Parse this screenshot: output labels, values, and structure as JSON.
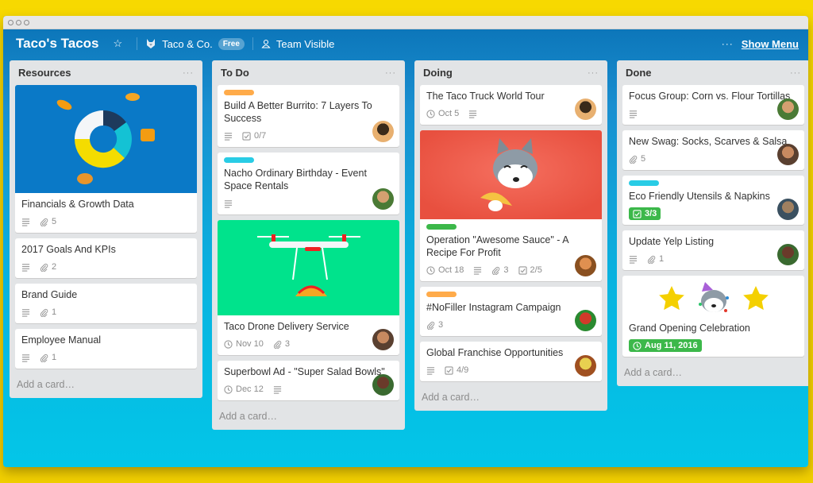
{
  "window": {
    "title_dots": [
      "close",
      "minimize",
      "zoom"
    ]
  },
  "header": {
    "board_title": "Taco's Tacos",
    "star_icon": "star-icon",
    "team_name": "Taco & Co.",
    "team_plan_badge": "Free",
    "visibility_label": "Team Visible",
    "more_label": "···",
    "show_menu_label": "Show Menu"
  },
  "lists": [
    {
      "title": "Resources",
      "menu": "···",
      "add_card": "Add a card…",
      "cards": [
        {
          "title": "Financials & Growth Data",
          "cover": "donut-chart-tacos",
          "cover_color": "#0a79c7",
          "description": true,
          "attachments": "5"
        },
        {
          "title": "2017 Goals And KPIs",
          "description": true,
          "attachments": "2"
        },
        {
          "title": "Brand Guide",
          "description": true,
          "attachments": "1"
        },
        {
          "title": "Employee Manual",
          "description": true,
          "attachments": "1"
        }
      ]
    },
    {
      "title": "To Do",
      "menu": "···",
      "add_card": "Add a card…",
      "cards": [
        {
          "title": "Build A Better Burrito: 7 Layers To Success",
          "label_color": "#ffab4a",
          "description": true,
          "checklist": "0/7",
          "avatar": "member-1"
        },
        {
          "title": "Nacho Ordinary Birthday - Event Space Rentals",
          "label_color": "#29cce5",
          "description": true,
          "avatar": "member-2"
        },
        {
          "title": "Taco Drone Delivery Service",
          "cover": "taco-drone",
          "cover_color": "#00e38c",
          "due": "Nov 10",
          "attachments": "3",
          "avatar": "member-3"
        },
        {
          "title": "Superbowl Ad - \"Super Salad Bowls\"",
          "due": "Dec 12",
          "description": true,
          "avatar": "member-4"
        }
      ]
    },
    {
      "title": "Doing",
      "menu": "···",
      "add_card": "Add a card…",
      "cards": [
        {
          "title": "The Taco Truck World Tour",
          "due": "Oct 5",
          "description": true,
          "avatar": "member-1"
        },
        {
          "title": "Operation \"Awesome Sauce\" - A Recipe For Profit",
          "cover": "husky-taco",
          "cover_color": "#eb5a46",
          "label_color": "#3cb84a",
          "due": "Oct 18",
          "description": true,
          "attachments": "3",
          "checklist": "2/5",
          "avatar": "member-5"
        },
        {
          "title": "#NoFiller Instagram Campaign",
          "label_color": "#ffab4a",
          "attachments": "3",
          "avatar": "member-6"
        },
        {
          "title": "Global Franchise Opportunities",
          "description": true,
          "checklist": "4/9",
          "avatar": "member-7"
        }
      ]
    },
    {
      "title": "Done",
      "menu": "···",
      "add_card": "Add a card…",
      "cards": [
        {
          "title": "Focus Group: Corn vs. Flour Tortillas",
          "description": true,
          "avatar": "member-2"
        },
        {
          "title": "New Swag: Socks, Scarves & Salsa",
          "attachments": "5",
          "avatar": "member-3"
        },
        {
          "title": "Eco Friendly Utensils & Napkins",
          "label_color": "#29cce5",
          "checklist_complete": "3/3",
          "avatar": "member-8"
        },
        {
          "title": "Update Yelp Listing",
          "description": true,
          "attachments": "1",
          "avatar": "member-4"
        },
        {
          "title": "Grand Opening Celebration",
          "stickers": [
            "star",
            "party-husky",
            "star"
          ],
          "due_complete": "Aug 11, 2016"
        }
      ]
    }
  ],
  "colors": {
    "header_blue": "#0a72b6",
    "board_bottom": "#03c6e8",
    "label_orange": "#ffab4a",
    "label_blue": "#29cce5",
    "label_green": "#3cb84a",
    "outer_yellow": "#f7d900"
  }
}
